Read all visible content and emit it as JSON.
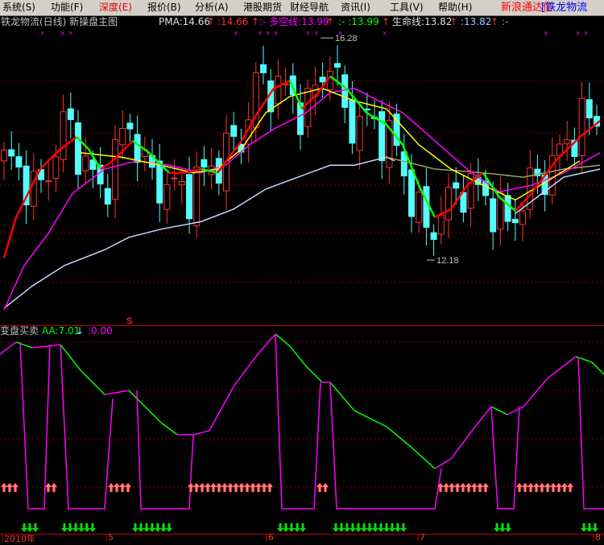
{
  "menu": {
    "items": [
      "系统(S)",
      "功能(F)",
      "深度(E)",
      "报价(B)",
      "分析(A)",
      "港股期货",
      "财经导航",
      "资讯(I)",
      "工具(V)",
      "帮助(H)"
    ],
    "active_index": 2,
    "brand": "新浪通达信",
    "stock_tab": "[铁龙物流"
  },
  "main_header": {
    "title": "铁龙物流(日线) 新操盘主图",
    "pma_label": "PMA:14.66",
    "pma_value": ":14.66",
    "duokong_label": ":- 多空线:13.99",
    "duokong_value": ":- :13.99",
    "life_label": "生命线:13.82",
    "life_value": ":13.82",
    "tail": ":-",
    "up_arrow": "↑"
  },
  "annotations": {
    "high_label": "16.28",
    "low_label": "12.18",
    "signal_s": "S"
  },
  "sub_header": {
    "title": "变盘买卖",
    "aa_label": "AA:7.01",
    "down_arrow": "↓",
    "zero_value": ":0.00"
  },
  "time_axis": [
    {
      "label": "2010年",
      "t": 0.3
    },
    {
      "label": "5",
      "t": 13.2
    },
    {
      "label": "6",
      "t": 33.1
    },
    {
      "label": "7",
      "t": 51.9
    },
    {
      "label": "8",
      "t": 73.7
    }
  ],
  "colors": {
    "up": "#ff3232",
    "down": "#54fcfc",
    "pma_up": "#ff0000",
    "pma_down": "#00ff00",
    "duokong": "#ffff00",
    "magenta": "#ff00ff",
    "life": "#c8d8ff",
    "khaki": "#a0a060",
    "grid": "#800000"
  },
  "chart_data": {
    "type": "candlestick",
    "price_range": [
      10.98,
      16.98
    ],
    "high": 16.28,
    "low": 12.18,
    "close_path": [
      [
        1,
        14.01
      ],
      [
        5,
        13.41
      ],
      [
        8,
        14.75
      ],
      [
        10,
        14.16
      ],
      [
        12.5,
        13.41
      ],
      [
        16,
        14.75
      ],
      [
        18.5,
        13.71
      ],
      [
        23,
        13.41
      ],
      [
        27,
        14.01
      ],
      [
        30,
        14.45
      ],
      [
        32,
        15.49
      ],
      [
        35,
        15.35
      ],
      [
        38,
        14.9
      ],
      [
        41,
        15.94
      ],
      [
        43,
        14.75
      ],
      [
        46,
        14.75
      ],
      [
        49,
        14.31
      ],
      [
        51,
        13.41
      ],
      [
        53,
        12.67
      ],
      [
        55,
        13.12
      ],
      [
        57.5,
        13.56
      ],
      [
        60,
        13.41
      ],
      [
        63,
        12.82
      ],
      [
        66,
        13.56
      ],
      [
        69,
        14.01
      ],
      [
        72,
        14.75
      ],
      [
        74.5,
        14.75
      ]
    ],
    "pma": [
      [
        0.5,
        12.22
      ],
      [
        2,
        12.97
      ],
      [
        5,
        13.86
      ],
      [
        7.5,
        14.23
      ],
      [
        9.5,
        14.45
      ],
      [
        11,
        14.23
      ],
      [
        12.5,
        13.86
      ],
      [
        14,
        14.01
      ],
      [
        16.5,
        14.38
      ],
      [
        18.5,
        14.16
      ],
      [
        21,
        13.79
      ],
      [
        23,
        13.79
      ],
      [
        25,
        13.86
      ],
      [
        27,
        13.79
      ],
      [
        30,
        14.38
      ],
      [
        32,
        14.9
      ],
      [
        34,
        15.35
      ],
      [
        36,
        15.49
      ],
      [
        37.5,
        14.97
      ],
      [
        39.5,
        15.27
      ],
      [
        41,
        15.57
      ],
      [
        43,
        15.35
      ],
      [
        45.5,
        14.9
      ],
      [
        48,
        14.68
      ],
      [
        50,
        14.31
      ],
      [
        52,
        13.56
      ],
      [
        54,
        12.97
      ],
      [
        56,
        13.12
      ],
      [
        58,
        13.56
      ],
      [
        60,
        13.79
      ],
      [
        62,
        13.34
      ],
      [
        64,
        13.09
      ],
      [
        66,
        13.41
      ],
      [
        69,
        14.01
      ],
      [
        72,
        14.45
      ],
      [
        74.5,
        14.75
      ]
    ],
    "duokong": [
      [
        10,
        14.16
      ],
      [
        15,
        14.08
      ],
      [
        20,
        13.93
      ],
      [
        24,
        13.79
      ],
      [
        27,
        13.86
      ],
      [
        30,
        14.23
      ],
      [
        33,
        14.9
      ],
      [
        36,
        15.2
      ],
      [
        40,
        15.35
      ],
      [
        44,
        15.12
      ],
      [
        48,
        14.97
      ],
      [
        52,
        14.31
      ],
      [
        56,
        13.86
      ],
      [
        60,
        13.56
      ],
      [
        64,
        13.29
      ],
      [
        68,
        13.64
      ],
      [
        72,
        14.01
      ]
    ],
    "khaki": [
      [
        48,
        14.08
      ],
      [
        54,
        13.86
      ],
      [
        60,
        13.79
      ],
      [
        65,
        13.71
      ],
      [
        70,
        13.86
      ],
      [
        74.5,
        13.93
      ]
    ],
    "magenta_ma": [
      [
        0.5,
        11.26
      ],
      [
        3,
        12.08
      ],
      [
        6,
        12.67
      ],
      [
        9,
        13.41
      ],
      [
        13,
        13.86
      ],
      [
        17,
        14.01
      ],
      [
        21,
        13.93
      ],
      [
        25,
        13.79
      ],
      [
        28,
        13.93
      ],
      [
        31,
        14.31
      ],
      [
        34,
        14.6
      ],
      [
        38,
        14.9
      ],
      [
        41,
        15.27
      ],
      [
        44,
        15.35
      ],
      [
        47,
        15.12
      ],
      [
        50,
        14.9
      ],
      [
        54,
        14.38
      ],
      [
        58,
        13.86
      ],
      [
        62,
        13.44
      ],
      [
        66,
        13.56
      ],
      [
        70,
        13.79
      ],
      [
        74.5,
        14.16
      ]
    ],
    "life": [
      [
        0.5,
        11.29
      ],
      [
        4,
        11.7
      ],
      [
        8,
        12.08
      ],
      [
        13,
        12.37
      ],
      [
        16,
        12.6
      ],
      [
        20,
        12.75
      ],
      [
        25,
        12.89
      ],
      [
        29,
        13.12
      ],
      [
        33,
        13.49
      ],
      [
        37,
        13.71
      ],
      [
        41,
        13.93
      ],
      [
        44,
        13.93
      ],
      [
        48,
        14.08
      ],
      [
        49,
        14.01
      ]
    ],
    "life2": [
      [
        64,
        13.04
      ],
      [
        70,
        13.71
      ],
      [
        74.5,
        13.86
      ]
    ],
    "aa_curve": [
      [
        0,
        88.5
      ],
      [
        2,
        95.4
      ],
      [
        4,
        92.2
      ],
      [
        6,
        93.1
      ],
      [
        7.5,
        94
      ],
      [
        10,
        79.3
      ],
      [
        13,
        65.4
      ],
      [
        16,
        67.7
      ],
      [
        18,
        58.5
      ],
      [
        20,
        49.3
      ],
      [
        22,
        42.4
      ],
      [
        24,
        42.4
      ],
      [
        26,
        44.7
      ],
      [
        29,
        70
      ],
      [
        32,
        88.5
      ],
      [
        34.2,
        100
      ],
      [
        36,
        93.1
      ],
      [
        38,
        81.6
      ],
      [
        40,
        72.4
      ],
      [
        41,
        72.4
      ],
      [
        44,
        56.2
      ],
      [
        48,
        47
      ],
      [
        51,
        35.5
      ],
      [
        54,
        23
      ],
      [
        56,
        28.6
      ],
      [
        59,
        47
      ],
      [
        61,
        58.5
      ],
      [
        63,
        53.9
      ],
      [
        65,
        58.5
      ],
      [
        68,
        74.7
      ],
      [
        71.5,
        87.1
      ],
      [
        73.5,
        83.9
      ],
      [
        75,
        77
      ]
    ],
    "aa_drops": [
      [
        [
          2.5,
          95.4
        ],
        [
          3.5,
          0
        ],
        [
          5.5,
          0
        ],
        [
          6.2,
          94
        ]
      ],
      [
        [
          7.5,
          94
        ],
        [
          8.5,
          0
        ],
        [
          13,
          0
        ],
        [
          14,
          63
        ]
      ],
      [
        [
          17,
          67.7
        ],
        [
          17.5,
          0
        ],
        [
          23.5,
          0
        ],
        [
          24,
          42.4
        ]
      ],
      [
        [
          34.2,
          100
        ],
        [
          35,
          0
        ],
        [
          39,
          0
        ],
        [
          39.8,
          72.4
        ]
      ],
      [
        [
          41,
          72.4
        ],
        [
          41.8,
          0
        ],
        [
          54,
          0
        ],
        [
          54.8,
          23
        ]
      ],
      [
        [
          61,
          58.5
        ],
        [
          61.8,
          0
        ],
        [
          63.8,
          0
        ],
        [
          64.5,
          58.5
        ]
      ],
      [
        [
          71.8,
          87.1
        ],
        [
          72.5,
          0
        ],
        [
          75,
          0
        ]
      ]
    ],
    "buy_arrows": [
      [
        0.5,
        3
      ],
      [
        6,
        2
      ],
      [
        13.8,
        4
      ],
      [
        23.7,
        15
      ],
      [
        39.7,
        2
      ],
      [
        54.7,
        9
      ],
      [
        64.5,
        10
      ]
    ],
    "sell_arrows": [
      [
        3,
        3
      ],
      [
        8,
        6
      ],
      [
        16.8,
        7
      ],
      [
        34.8,
        5
      ],
      [
        41.7,
        13
      ],
      [
        61.7,
        3
      ],
      [
        72.5,
        3
      ]
    ],
    "top_markers": [
      5,
      7.5,
      8.5,
      29,
      32,
      33,
      34,
      38,
      39,
      42,
      47.5,
      67.5,
      71.5,
      72.5
    ]
  }
}
